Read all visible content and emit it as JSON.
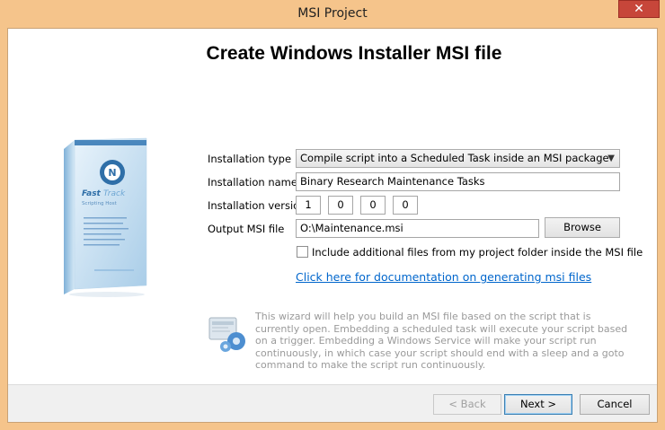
{
  "window": {
    "title": "MSI Project",
    "close_glyph": "✕"
  },
  "page": {
    "heading": "Create Windows Installer MSI file"
  },
  "form": {
    "installation_type_label": "Installation type",
    "installation_type_value": "Compile script into a Scheduled Task inside an MSI package",
    "installation_name_label": "Installation name",
    "installation_name_value": "Binary Research Maintenance Tasks",
    "installation_version_label": "Installation version",
    "version": [
      "1",
      "0",
      "0",
      "0"
    ],
    "output_label": "Output MSI file",
    "output_value": "O:\\Maintenance.msi",
    "browse_label": "Browse",
    "include_files_label": "Include additional files from my project folder inside the MSI file",
    "include_files_checked": false,
    "doc_link": "Click here for documentation on generating msi files"
  },
  "info": {
    "text": "This wizard will help you build an MSI file based on the script that is currently open. Embedding a scheduled task will execute your script based on a trigger. Embedding a Windows Service will make your script run continuously, in which case your script should end with a sleep and a goto command to make the script run continuously."
  },
  "footer": {
    "back_label": "< Back",
    "next_label": "Next >",
    "cancel_label": "Cancel"
  },
  "product_box": {
    "brand_line1": "Fast",
    "brand_line2": "Track",
    "brand_sub": "Scripting Host"
  },
  "colors": {
    "frame": "#f5c48b",
    "link": "#0066cc",
    "close": "#c7463a"
  }
}
